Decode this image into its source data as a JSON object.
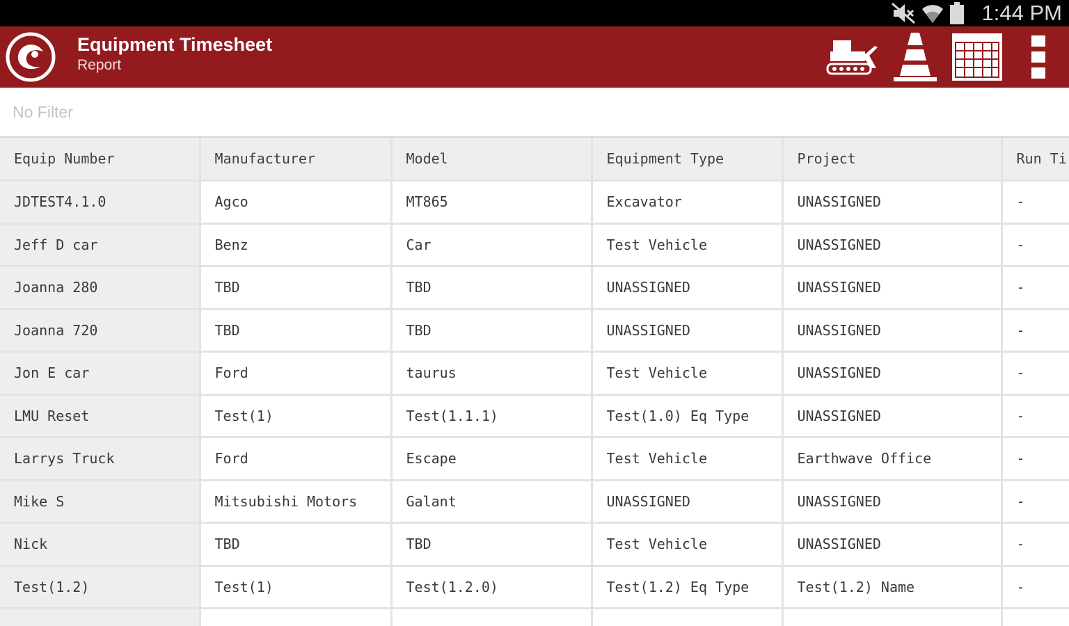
{
  "status_bar": {
    "time": "1:44 PM",
    "icons": [
      "mute-icon",
      "wifi-icon",
      "battery-icon"
    ]
  },
  "header": {
    "title": "Equipment Timesheet",
    "subtitle": "Report",
    "background": "#931b1e",
    "actions": [
      "bulldozer-icon",
      "traffic-cone-icon",
      "calendar-icon",
      "overflow-menu-icon"
    ]
  },
  "filter": {
    "text": "No Filter"
  },
  "table": {
    "columns": [
      "Equip Number",
      "Manufacturer",
      "Model",
      "Equipment Type",
      "Project",
      "Run Ti"
    ],
    "rows": [
      [
        "JDTEST4.1.0",
        "Agco",
        "MT865",
        "Excavator",
        "UNASSIGNED",
        "-"
      ],
      [
        "Jeff D car",
        "Benz",
        "Car",
        "Test Vehicle",
        "UNASSIGNED",
        "-"
      ],
      [
        "Joanna 280",
        "TBD",
        "TBD",
        "UNASSIGNED",
        "UNASSIGNED",
        "-"
      ],
      [
        "Joanna 720",
        "TBD",
        "TBD",
        "UNASSIGNED",
        "UNASSIGNED",
        "-"
      ],
      [
        "Jon E car",
        "Ford",
        "taurus",
        "Test Vehicle",
        "UNASSIGNED",
        "-"
      ],
      [
        "LMU Reset",
        "Test(1)",
        "Test(1.1.1)",
        "Test(1.0) Eq Type",
        "UNASSIGNED",
        "-"
      ],
      [
        "Larrys Truck",
        "Ford",
        "Escape",
        "Test Vehicle",
        "Earthwave Office",
        "-"
      ],
      [
        "Mike S",
        "Mitsubishi Motors",
        "Galant",
        "UNASSIGNED",
        "UNASSIGNED",
        "-"
      ],
      [
        "Nick",
        "TBD",
        "TBD",
        "Test Vehicle",
        "UNASSIGNED",
        "-"
      ],
      [
        "Test(1.2)",
        "Test(1)",
        "Test(1.2.0)",
        "Test(1.2) Eq Type",
        "Test(1.2) Name",
        "-"
      ],
      [
        "",
        "",
        "",
        "",
        "",
        ""
      ]
    ]
  }
}
